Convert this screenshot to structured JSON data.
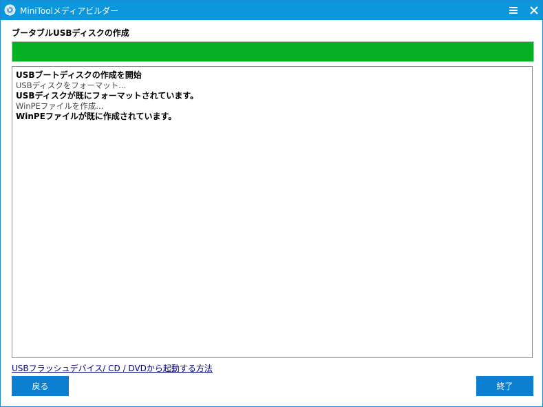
{
  "window": {
    "title": "MiniToolメディアビルダー",
    "app_icon": "disc-icon",
    "menu_icon": "hamburger-menu-icon",
    "close_icon": "close-icon"
  },
  "heading": "ブータブルUSBディスクの作成",
  "progress": {
    "percent": 100,
    "color": "#06b025"
  },
  "log": [
    {
      "text": "USBブートディスクの作成を開始",
      "bold": true
    },
    {
      "text": "USBディスクをフォーマット...",
      "bold": false
    },
    {
      "text": "USBディスクが既にフォーマットされています。",
      "bold": true
    },
    {
      "text": "WinPEファイルを作成...",
      "bold": false
    },
    {
      "text": "WinPEファイルが既に作成されています。",
      "bold": true
    }
  ],
  "help_link": "USBフラッシュデバイス/ CD / DVDから起動する方法",
  "buttons": {
    "back": "戻る",
    "finish": "終了"
  },
  "colors": {
    "titlebar": "#0c97dc",
    "button": "#0c7fd0",
    "link": "#000080"
  }
}
